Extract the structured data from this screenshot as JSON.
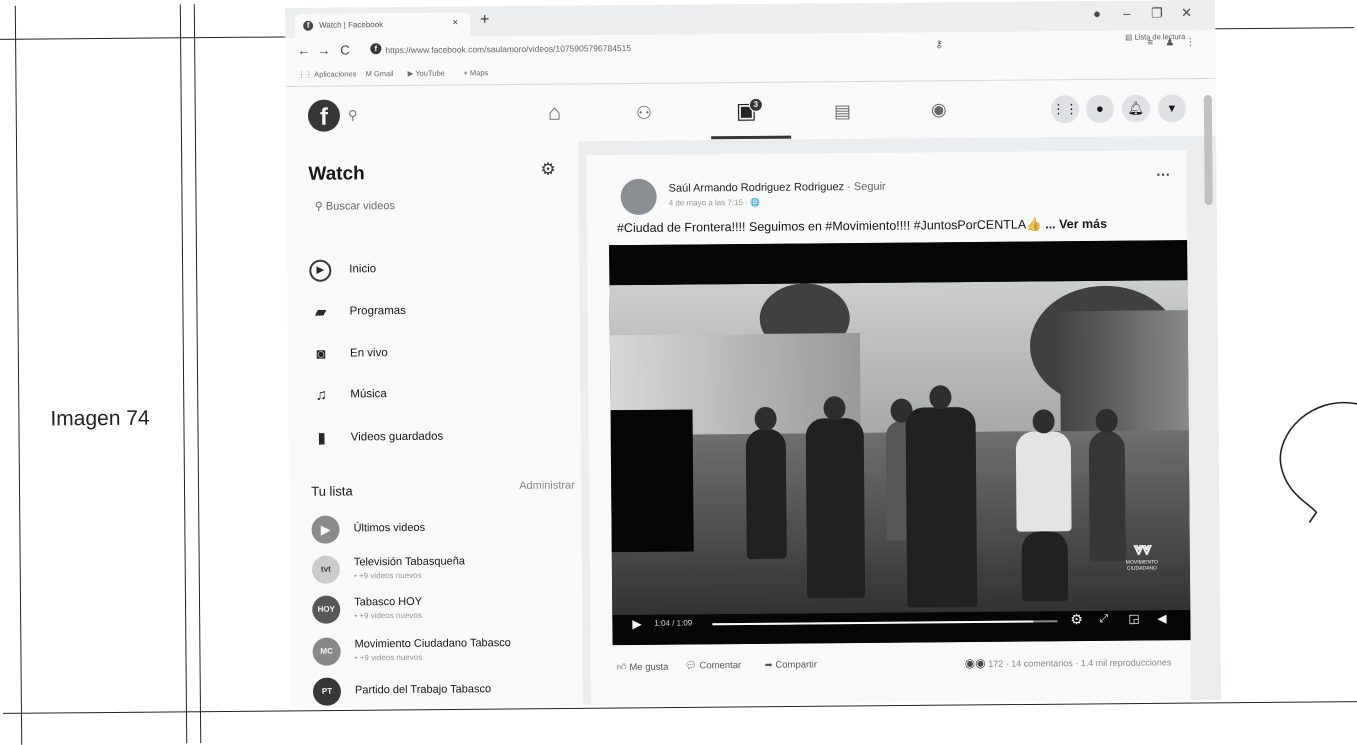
{
  "document": {
    "row_label": "Imagen 74"
  },
  "browser": {
    "tab_title": "Watch | Facebook",
    "tab_close": "×",
    "new_tab": "+",
    "url": "https://www.facebook.com/saulamoro/videos/1075905796784515",
    "reading_list": "Lista de lectura",
    "bookmarks": [
      "Aplicaciones",
      "Gmail",
      "YouTube",
      "Maps"
    ]
  },
  "facebook": {
    "watch_badge": "3",
    "sidebar": {
      "title": "Watch",
      "search_placeholder": "Buscar videos",
      "menu": [
        {
          "label": "Inicio",
          "icon": "watch-icon"
        },
        {
          "label": "Programas",
          "icon": "shows-icon"
        },
        {
          "label": "En vivo",
          "icon": "live-icon"
        },
        {
          "label": "Música",
          "icon": "music-icon"
        },
        {
          "label": "Videos guardados",
          "icon": "bookmark-icon"
        }
      ],
      "your_list": "Tu lista",
      "manage": "Administrar",
      "list": [
        {
          "name": "Últimos videos",
          "sub": ""
        },
        {
          "name": "Televisión Tabasqueña",
          "sub": "• +9 videos nuevos",
          "avatar": "tvt"
        },
        {
          "name": "Tabasco HOY",
          "sub": "• +9 videos nuevos",
          "avatar": "HOY"
        },
        {
          "name": "Movimiento Ciudadano Tabasco",
          "sub": "• +9 videos nuevos",
          "avatar": "MC"
        },
        {
          "name": "Partido del Trabajo Tabasco",
          "sub": "",
          "avatar": "PT"
        }
      ]
    },
    "post": {
      "author": "Saúl Armando Rodriguez Rodriguez",
      "follow": " · Seguir",
      "date": "4 de mayo a las 7:15 · 🌐",
      "more": "···",
      "caption": "#Ciudad de Frontera!!!! Seguimos en #Movimiento!!!! #JuntosPorCENTLA👍",
      "see_more": " ... Ver más",
      "video": {
        "time": "1:04 / 1:09",
        "progress": 0.93,
        "brand": "MOVIMIENTO CIUDADANO"
      },
      "actions": {
        "like": "Me gusta",
        "comment": "Comentar",
        "share": "Compartir",
        "stats": "172 · 14 comentarios · 1.4 mil reproducciones"
      }
    }
  }
}
